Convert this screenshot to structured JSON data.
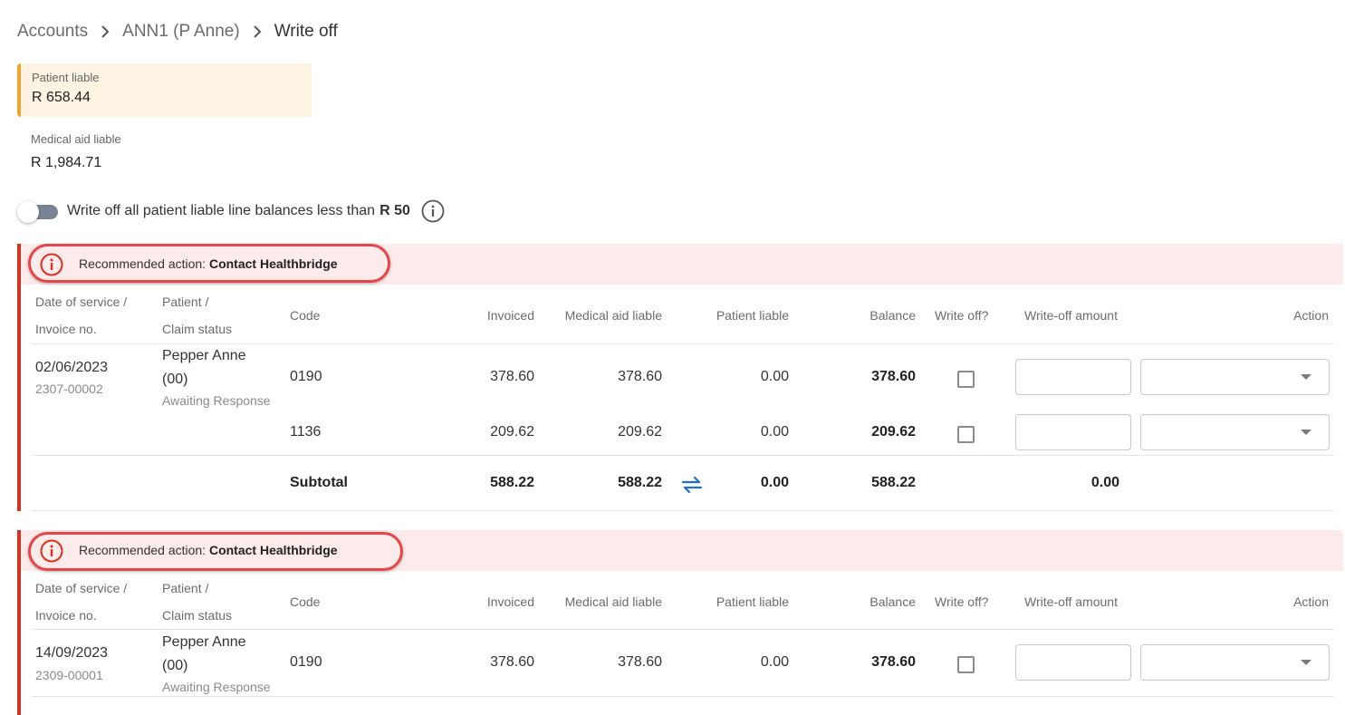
{
  "breadcrumb": {
    "items": [
      "Accounts",
      "ANN1 (P Anne)",
      "Write off"
    ]
  },
  "summary": {
    "patient_liable_label": "Patient liable",
    "patient_liable_value": "R 658.44",
    "medical_aid_liable_label": "Medical aid liable",
    "medical_aid_liable_value": "R 1,984.71"
  },
  "toggle": {
    "label": "Write off all patient liable line balances less than",
    "threshold": "R 50",
    "enabled": false
  },
  "headers": {
    "date_line1": "Date of service /",
    "date_line2": "Invoice no.",
    "patient_line1": "Patient /",
    "patient_line2": "Claim status",
    "code": "Code",
    "invoiced": "Invoiced",
    "medical_aid_liable": "Medical aid liable",
    "patient_liable": "Patient liable",
    "balance": "Balance",
    "write_off": "Write off?",
    "write_off_amount": "Write-off amount",
    "action": "Action"
  },
  "groups": [
    {
      "recommended_prefix": "Recommended action:",
      "recommended_action": "Contact Healthbridge",
      "date": "02/06/2023",
      "invoice_no": "2307-00002",
      "patient_name_line1": "Pepper Anne",
      "patient_name_line2": "(00)",
      "claim_status": "Awaiting Response",
      "lines": [
        {
          "code": "0190",
          "invoiced": "378.60",
          "medical_aid_liable": "378.60",
          "patient_liable": "0.00",
          "balance": "378.60",
          "write_off": false,
          "write_off_amount": "",
          "action": ""
        },
        {
          "code": "1136",
          "invoiced": "209.62",
          "medical_aid_liable": "209.62",
          "patient_liable": "0.00",
          "balance": "209.62",
          "write_off": false,
          "write_off_amount": "",
          "action": ""
        }
      ],
      "subtotal": {
        "label": "Subtotal",
        "invoiced": "588.22",
        "medical_aid_liable": "588.22",
        "patient_liable": "0.00",
        "balance": "588.22",
        "write_off_amount": "0.00"
      }
    },
    {
      "recommended_prefix": "Recommended action:",
      "recommended_action": "Contact Healthbridge",
      "date": "14/09/2023",
      "invoice_no": "2309-00001",
      "patient_name_line1": "Pepper Anne",
      "patient_name_line2": "(00)",
      "claim_status": "Awaiting Response",
      "lines": [
        {
          "code": "0190",
          "invoiced": "378.60",
          "medical_aid_liable": "378.60",
          "patient_liable": "0.00",
          "balance": "378.60",
          "write_off": false,
          "write_off_amount": "",
          "action": ""
        }
      ]
    }
  ],
  "icons": {
    "breadcrumb_separator": "chevron-right-icon",
    "info": "info-icon",
    "warning": "alert-circle-icon",
    "swap": "swap-arrows-icon"
  },
  "colors": {
    "alert_red": "#d63222",
    "alert_bg": "#fdeaea",
    "patient_card_bg": "#fdf3e3",
    "patient_card_accent": "#f0a32e",
    "swap_blue": "#1e6fd0",
    "annotation_ring": "#e3474a"
  }
}
